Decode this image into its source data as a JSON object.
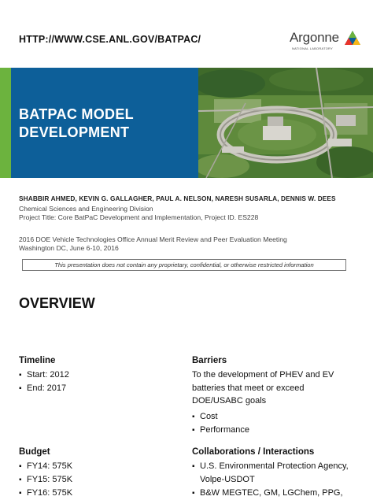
{
  "header": {
    "url": "HTTP://WWW.CSE.ANL.GOV/BATPAC/",
    "logo_name": "Argonne",
    "logo_sub": "NATIONAL LABORATORY"
  },
  "banner": {
    "title_line1": "BATPAC MODEL",
    "title_line2": "DEVELOPMENT"
  },
  "info": {
    "authors": "SHABBIR AHMED, KEVIN G. GALLAGHER, PAUL A. NELSON, NARESH SUSARLA, DENNIS W. DEES",
    "division": "Chemical Sciences and Engineering Division",
    "project": "Project Title: Core BatPaC Development and Implementation, Project ID. ES228",
    "meeting": "2016 DOE Vehicle Technologies Office Annual Merit Review and Peer Evaluation Meeting",
    "location": "Washington DC, June 6-10, 2016",
    "notice": "This presentation does not contain any proprietary, confidential, or otherwise restricted information"
  },
  "overview": {
    "heading": "OVERVIEW",
    "timeline": {
      "heading": "Timeline",
      "items": [
        "Start: 2012",
        "End: 2017"
      ]
    },
    "budget": {
      "heading": "Budget",
      "items": [
        "FY14: 575K",
        "FY15: 575K",
        "FY16: 575K"
      ]
    },
    "barriers": {
      "heading": "Barriers",
      "intro": "To the development of PHEV and EV batteries that meet or exceed DOE/USABC goals",
      "items": [
        "Cost",
        "Performance"
      ]
    },
    "collaborations": {
      "heading": "Collaborations / Interactions",
      "items": [
        "U.S. Environmental Protection Agency, Volpe-USDOT",
        "B&W MEGTEC, GM, LGChem, PPG,"
      ]
    }
  },
  "colors": {
    "brand_blue": "#0d5f99",
    "brand_green": "#6cb33e"
  }
}
